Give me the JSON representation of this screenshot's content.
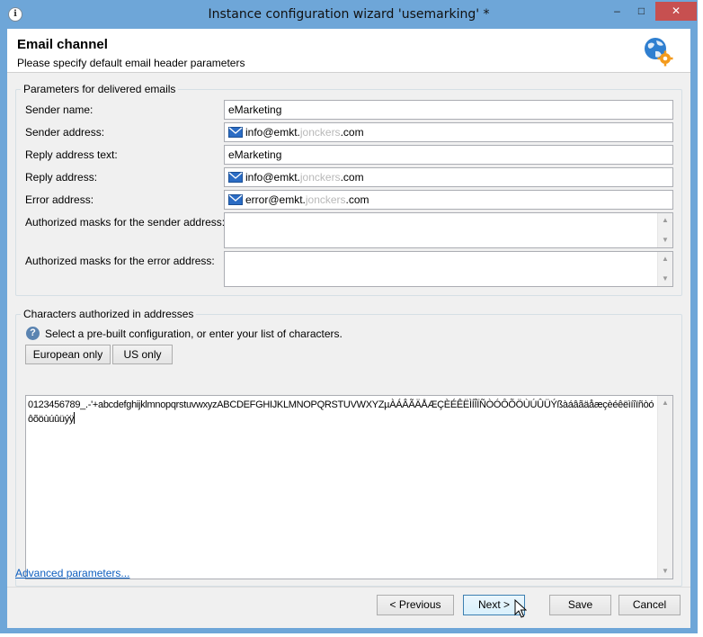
{
  "window": {
    "title": "Instance configuration wizard 'usemarking' *",
    "minimize": "–",
    "maximize": "□",
    "close": "✕"
  },
  "header": {
    "title": "Email channel",
    "subtitle": "Please specify default email header parameters",
    "icon": "globe-gear-icon"
  },
  "params_group": {
    "legend": "Parameters for delivered emails",
    "sender_name": {
      "label": "Sender name:",
      "value": "eMarketing"
    },
    "sender_address": {
      "label": "Sender address:",
      "prefix": "info@emkt.",
      "blurred": "jonckers",
      "suffix": ".com"
    },
    "reply_text": {
      "label": "Reply address text:",
      "value": "eMarketing"
    },
    "reply_address": {
      "label": "Reply address:",
      "prefix": "info@emkt.",
      "blurred": "jonckers",
      "suffix": ".com"
    },
    "error_address": {
      "label": "Error address:",
      "prefix": "error@emkt.",
      "blurred": "jonckers",
      "suffix": ".com"
    },
    "sender_masks": {
      "label": "Authorized masks for the sender address:",
      "value": ""
    },
    "error_masks": {
      "label": "Authorized masks for the error address:",
      "value": ""
    }
  },
  "chars_group": {
    "legend": "Characters authorized in addresses",
    "help_text": "Select a pre-built configuration, or enter your list of characters.",
    "european_button": "European only",
    "us_button": "US only",
    "characters": "0123456789_.-'+abcdefghijklmnopqrstuvwxyzABCDEFGHIJKLMNOPQRSTUVWXYZµÀÁÂÃÄÅÆÇÈÉÊËÌÍÎÏÑÒÓÔÕÖÙÚÛÜÝßàáâãäåæçèéêëìíîïñòóôõöùúûüýÿ"
  },
  "advanced_link": "Advanced parameters...",
  "footer": {
    "previous": "< Previous",
    "next": "Next >",
    "save": "Save",
    "cancel": "Cancel"
  },
  "colors": {
    "title_bar": "#6ea6d8",
    "close_button": "#c75050",
    "link": "#0d5ebf"
  }
}
